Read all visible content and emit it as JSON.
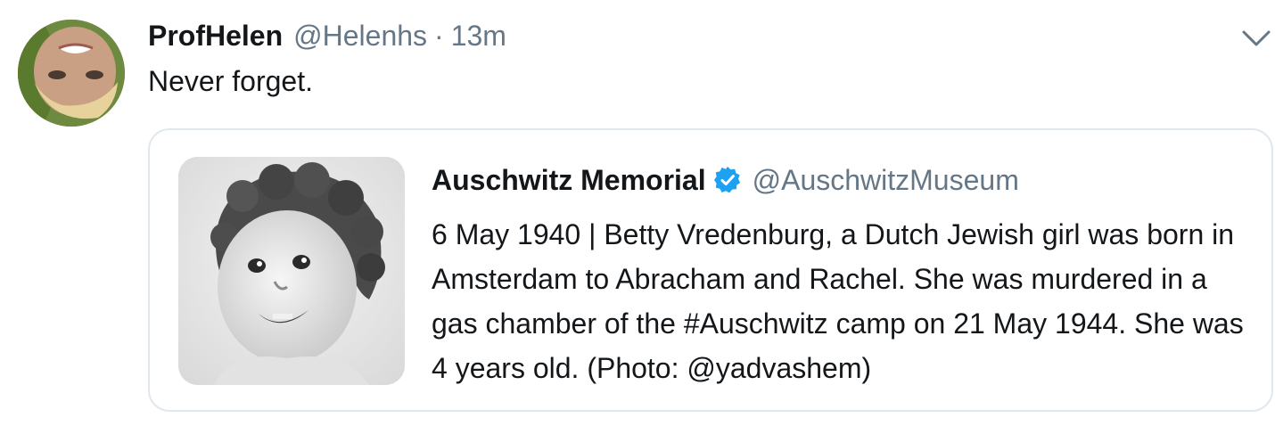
{
  "tweet": {
    "display_name": "ProfHelen",
    "handle": "@Helenhs",
    "separator": "·",
    "timestamp": "13m",
    "text": "Never forget.",
    "avatar_icon": "profile-avatar",
    "menu_icon": "chevron-down-icon"
  },
  "quoted": {
    "display_name": "Auschwitz Memorial",
    "verified_icon": "verified-badge-icon",
    "handle": "@AuschwitzMuseum",
    "text": "6 May 1940 | Betty Vredenburg, a Dutch Jewish girl was born in Amsterdam to Abracham and Rachel. She was murdered in a gas chamber of the #Auschwitz camp on 21 May 1944. She was 4 years old. (Photo: @yadvashem)",
    "photo_icon": "black-and-white-child-portrait"
  },
  "colors": {
    "text_primary": "#14171a",
    "text_secondary": "#657786",
    "border": "#e1e8ed",
    "verified_blue": "#1da1f2"
  }
}
